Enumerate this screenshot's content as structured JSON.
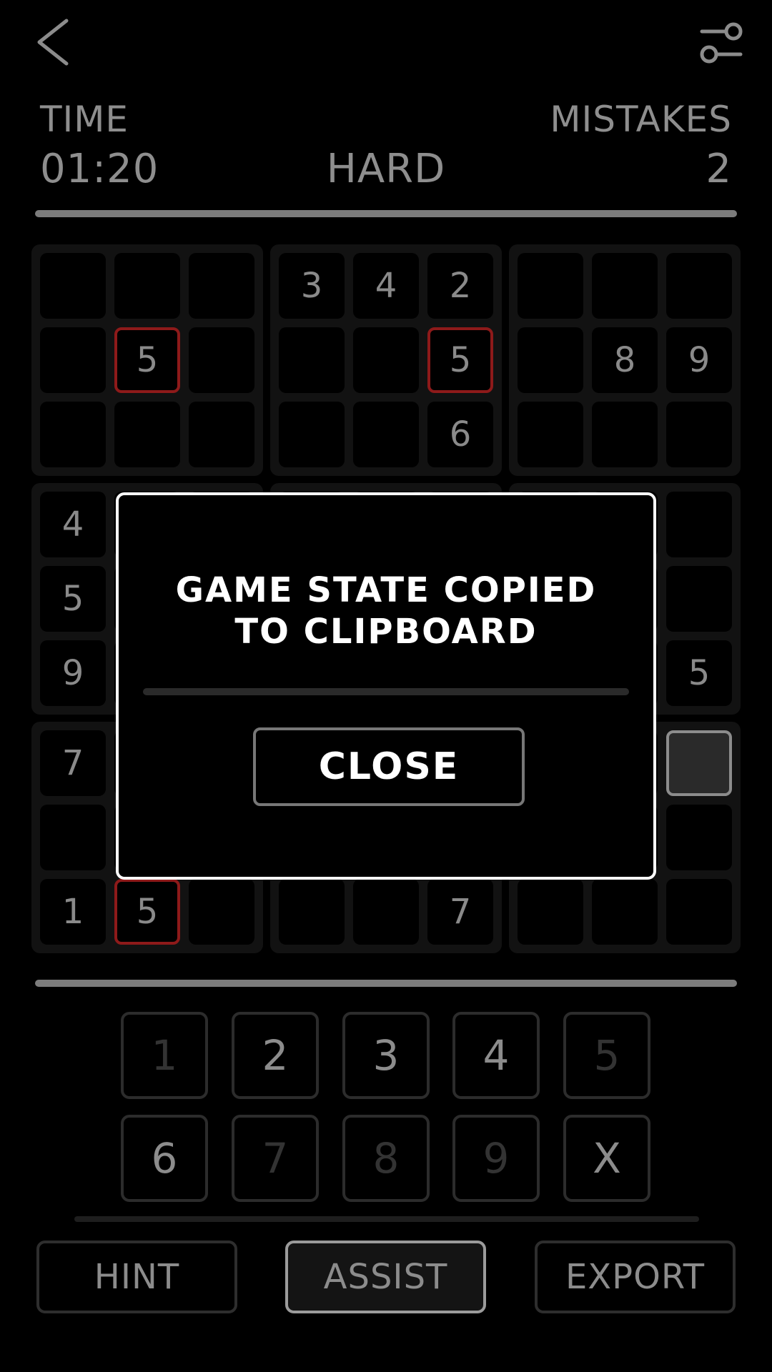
{
  "header": {
    "back_icon": "chevron-left-icon",
    "settings_icon": "sliders-icon",
    "time_label": "TIME",
    "time_value": "01:20",
    "difficulty": "HARD",
    "mistakes_label": "MISTAKES",
    "mistakes_value": "2"
  },
  "board": {
    "rows": [
      [
        "",
        "",
        "",
        "3",
        "4",
        "2",
        "",
        "",
        ""
      ],
      [
        "",
        "5",
        "",
        "",
        "",
        "5",
        "",
        "8",
        "9"
      ],
      [
        "",
        "",
        "",
        "",
        "",
        "6",
        "",
        "",
        ""
      ],
      [
        "4",
        "",
        "",
        "",
        "",
        "",
        "",
        "",
        ""
      ],
      [
        "5",
        "",
        "",
        "",
        "",
        "",
        "",
        "",
        ""
      ],
      [
        "9",
        "",
        "",
        "",
        "",
        "",
        "",
        "",
        "5"
      ],
      [
        "7",
        "",
        "",
        "",
        "",
        "",
        "",
        "",
        ""
      ],
      [
        "",
        "",
        "",
        "",
        "",
        "",
        "",
        "",
        ""
      ],
      [
        "1",
        "5",
        "",
        "",
        "",
        "7",
        "",
        "",
        ""
      ]
    ],
    "conflict_cells": [
      [
        1,
        1
      ],
      [
        1,
        5
      ],
      [
        8,
        1
      ]
    ],
    "selected_cell": [
      6,
      8
    ],
    "colors": {
      "conflict": "#8e1a1a",
      "selected": "#8c8c8c"
    }
  },
  "numpad": {
    "keys": [
      {
        "label": "1",
        "enabled": false
      },
      {
        "label": "2",
        "enabled": true
      },
      {
        "label": "3",
        "enabled": true
      },
      {
        "label": "4",
        "enabled": true
      },
      {
        "label": "5",
        "enabled": false
      },
      {
        "label": "6",
        "enabled": true
      },
      {
        "label": "7",
        "enabled": false
      },
      {
        "label": "8",
        "enabled": false
      },
      {
        "label": "9",
        "enabled": false
      },
      {
        "label": "X",
        "enabled": true
      }
    ]
  },
  "actions": {
    "hint_label": "HINT",
    "assist_label": "ASSIST",
    "export_label": "EXPORT"
  },
  "modal": {
    "message": "GAME STATE COPIED TO CLIPBOARD",
    "close_label": "CLOSE"
  }
}
